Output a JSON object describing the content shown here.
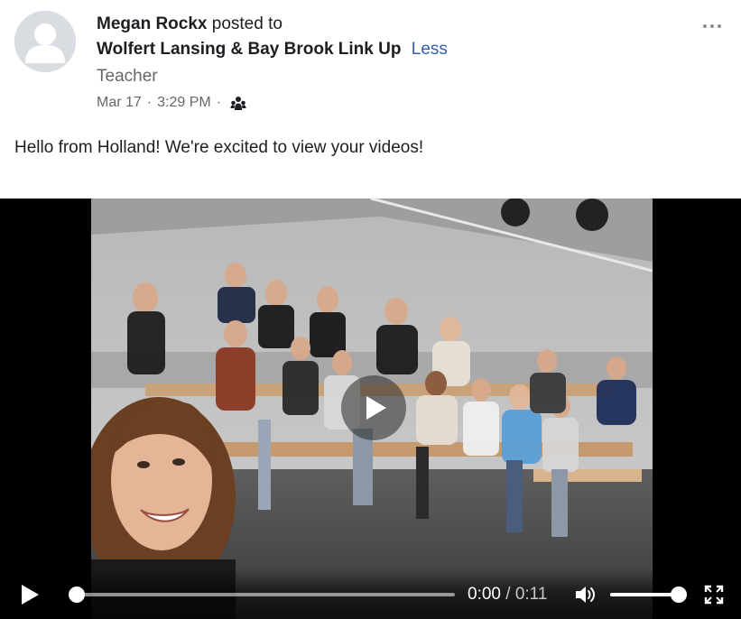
{
  "post": {
    "author": "Megan Rockx",
    "posted_to_text": "posted to",
    "group": "Wolfert Lansing & Bay Brook Link Up",
    "less_link": "Less",
    "role": "Teacher",
    "date": "Mar 17",
    "time": "3:29 PM",
    "separator": "·",
    "audience_icon": "group-audience-icon",
    "more_icon": "more-options-icon",
    "text": "Hello from Holland! We're excited to view your videos!"
  },
  "video": {
    "current_time": "0:00",
    "time_separator": "/",
    "duration": "0:11",
    "progress_fraction": 0.0,
    "volume_fraction": 0.9,
    "icons": {
      "play": "play-icon",
      "center_play": "play-overlay-icon",
      "volume": "volume-icon",
      "fullscreen": "fullscreen-icon"
    }
  },
  "colors": {
    "link": "#2d5fb4",
    "secondary_text": "#65676b",
    "player_bg": "#000000"
  }
}
